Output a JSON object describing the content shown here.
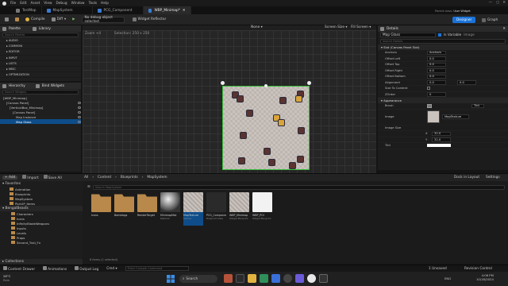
{
  "menu": {
    "items": [
      "File",
      "Edit",
      "Asset",
      "View",
      "Debug",
      "Window",
      "Tools",
      "Help"
    ]
  },
  "tabs": [
    {
      "label": "TestMap",
      "active": false
    },
    {
      "label": "MapSystem",
      "active": false
    },
    {
      "label": "PCG_Component",
      "active": false
    },
    {
      "label": "WBP_Minimap*",
      "active": true
    }
  ],
  "toolbar": {
    "compile": "Compile",
    "diff": "Diff",
    "debug_select": "No debug object selected",
    "widget_reflector": "Widget Reflector",
    "designer": "Designer",
    "graph": "Graph",
    "parent_class_label": "Parent class:",
    "parent_class": "User Widget"
  },
  "palette": {
    "title": "Palette",
    "library": "Library",
    "search_placeholder": "Search Palette",
    "categories": [
      "AUDIO",
      "COMMON",
      "EDITOR",
      "INPUT",
      "LISTS",
      "MISC",
      "OPTIMIZATION"
    ]
  },
  "hierarchy": {
    "title": "Hierarchy",
    "bind_widgets": "Bind Widgets",
    "search_placeholder": "Search Widgets",
    "items": [
      {
        "label": "[WBP_Minimap]",
        "indent": 0,
        "selected": false
      },
      {
        "label": "[Canvas Panel]",
        "indent": 1,
        "selected": false
      },
      {
        "label": "[VerticalBox_Minimap]",
        "indent": 2,
        "selected": false
      },
      {
        "label": "[Canvas Panel]",
        "indent": 3,
        "selected": false
      },
      {
        "label": "Map Instance",
        "indent": 4,
        "selected": false
      },
      {
        "label": "Map Glass",
        "indent": 4,
        "selected": true
      }
    ]
  },
  "viewport": {
    "zoom": "Zoom +4",
    "selection": "Selection: 250 x 250",
    "mode": "None",
    "screen_size": "Screen Size",
    "fill_screen": "Fill Screen"
  },
  "details": {
    "title": "Details",
    "widget_name": "Map Glass",
    "is_variable": "Is Variable",
    "image_tag": "Image",
    "search_placeholder": "Search Details",
    "slot_section": "Slot (Canvas Panel Slot)",
    "slot_rows": [
      {
        "name": "Anchors",
        "value": "Anchors"
      },
      {
        "name": "Offset Left",
        "value": "0.0"
      },
      {
        "name": "Offset Top",
        "value": "0.0"
      },
      {
        "name": "Offset Right",
        "value": "0.0"
      },
      {
        "name": "Offset Bottom",
        "value": "0.0"
      },
      {
        "name": "Alignment",
        "value": "0.0"
      },
      {
        "name": "Size To Content",
        "value": ""
      },
      {
        "name": "ZOrder",
        "value": "0"
      }
    ],
    "alignment_y": "0.0",
    "appearance_section": "Appearance",
    "brush_label": "Brush",
    "brush_tint": "Tint",
    "image_label": "Image",
    "image_value": "MapTexture",
    "image_size_label": "Image Size",
    "size_x": "32.0",
    "size_y": "32.0",
    "tint_label": "Tint"
  },
  "content_browser": {
    "add": "+ Add",
    "import": "Import",
    "save_all": "Save All",
    "breadcrumb": [
      "All",
      "Content",
      "Blueprints",
      "MapSystem"
    ],
    "settings": "Settings",
    "dock": "Dock in Layout",
    "search_placeholder": "Search MapSystem",
    "favorites": "Favorites",
    "favorite_items": [
      "Animation",
      "Blueprints",
      "MapSystem",
      "PickUP_Items"
    ],
    "project": "BengalBeasts",
    "folders": [
      "Characters",
      "Icons",
      "InfinityBladeWeapons",
      "Inputs",
      "Levels",
      "Props",
      "Second_Trail_Fx"
    ],
    "collections": "Collections",
    "assets": [
      {
        "label": "Icons",
        "sub": "",
        "kind": "folder"
      },
      {
        "label": "Bamidogs",
        "sub": "",
        "kind": "folder"
      },
      {
        "label": "RenderTarget",
        "sub": "",
        "kind": "folder"
      },
      {
        "label": "MinimapMat",
        "sub": "Material",
        "kind": "sphere"
      },
      {
        "label": "MapTexture",
        "sub": "Texture",
        "kind": "map",
        "selected": true
      },
      {
        "label": "PCG_Component",
        "sub": "Blueprint Class",
        "kind": "blueprint"
      },
      {
        "label": "WBP_Minimap",
        "sub": "Widget Blueprint",
        "kind": "map"
      },
      {
        "label": "WBP_POI",
        "sub": "Widget Blueprint",
        "kind": "white"
      }
    ],
    "item_count": "8 items (1 selected)"
  },
  "statusbar": {
    "content_drawer": "Content Drawer",
    "animations": "Animations",
    "output_log": "Output Log",
    "cmd": "Cmd",
    "console_placeholder": "Enter Console Command",
    "unsaved": "1 Unsaved",
    "revision": "Revision Control"
  },
  "taskbar": {
    "weather_temp": "28°C",
    "weather_desc": "Rain",
    "search": "Search",
    "lang": "ENG",
    "time": "4:06 PM",
    "date": "10/18/2024"
  },
  "colors": {
    "accent_blue": "#0e4d8a",
    "designer_blue": "#1a73d9",
    "selection_green": "#3bbd3b",
    "folder": "#b8894a"
  }
}
